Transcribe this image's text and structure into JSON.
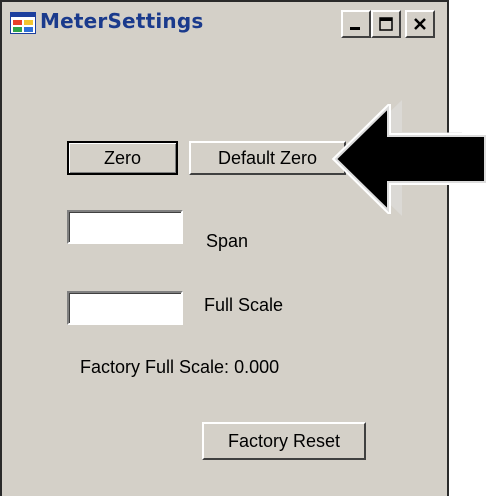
{
  "window": {
    "title": "MeterSettings",
    "controls": {
      "minimize": "minimize-icon",
      "maximize": "maximize-icon",
      "close": "close-icon"
    }
  },
  "buttons": {
    "zero": "Zero",
    "default_zero": "Default Zero",
    "factory_reset": "Factory Reset"
  },
  "fields": {
    "span": {
      "value": "",
      "label": "Span"
    },
    "full_scale": {
      "value": "",
      "label": "Full Scale"
    }
  },
  "factory_full_scale": {
    "label": "Factory Full Scale:",
    "value": "0.000"
  },
  "annotation": {
    "arrow": "arrow-left-icon",
    "color": "#000000"
  },
  "colors": {
    "window_bg": "#d4d0c8",
    "title_text": "#1a3a8c"
  }
}
